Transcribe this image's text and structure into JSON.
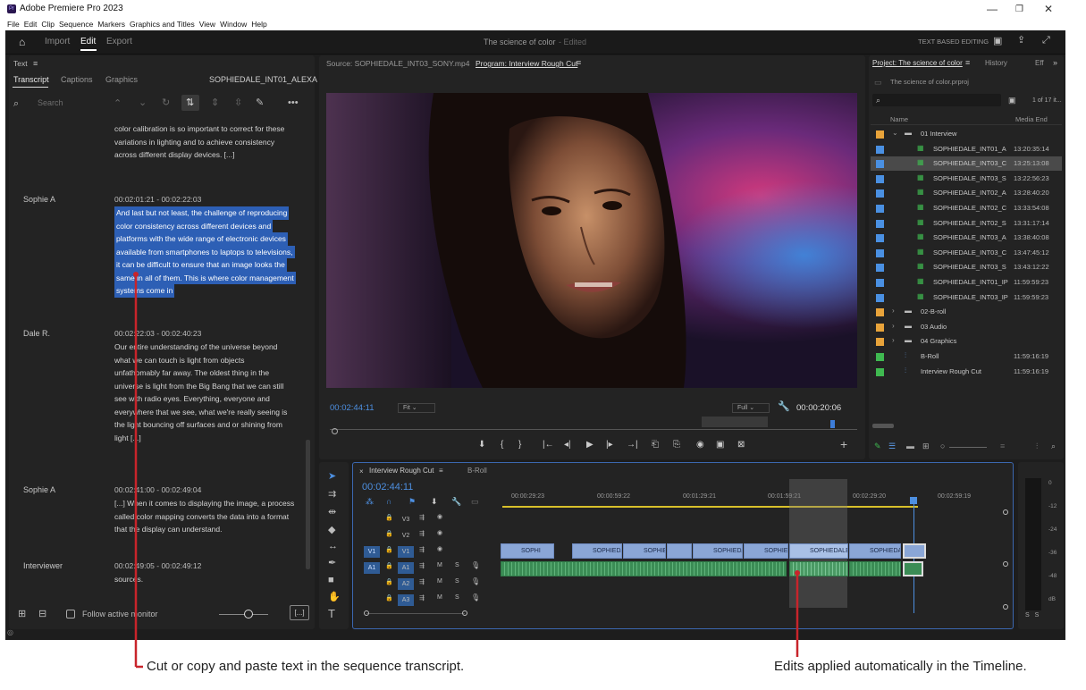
{
  "app": {
    "title": "Adobe Premiere Pro 2023",
    "logo_text": "Pr",
    "menus": [
      "File",
      "Edit",
      "Clip",
      "Sequence",
      "Markers",
      "Graphics and Titles",
      "View",
      "Window",
      "Help"
    ],
    "modes": [
      "Import",
      "Edit",
      "Export"
    ],
    "active_mode": "Edit",
    "project_name": "The science of color",
    "edited": "- Edited",
    "text_based_editing": "TEXT BASED EDITING"
  },
  "text_panel": {
    "title": "Text",
    "tabs": [
      "Transcript",
      "Captions",
      "Graphics"
    ],
    "active_tab": "Transcript",
    "clip_name": "SOPHIEDALE_INT01_ALEXA",
    "search_placeholder": "Search",
    "follow_label": "Follow active monitor",
    "ellipsis_btn": "[...]",
    "blocks": [
      {
        "speaker": "",
        "time": "",
        "lines": [
          "color calibration is so important to correct for these",
          "variations in lighting and to achieve consistency",
          "across different display devices. [...]"
        ],
        "highlight": false
      },
      {
        "speaker": "Sophie A",
        "time": "00:02:01:21 - 00:02:22:03",
        "lines": [
          "And last but not least, the challenge of reproducing",
          "color consistency across different devices and",
          "platforms with the wide range of electronic devices",
          "available from smartphones to laptops to televisions,",
          "it can be difficult to ensure that an image looks the",
          "same in all of them. This is where color management",
          "systems come in"
        ],
        "highlight": true
      },
      {
        "speaker": "Dale R.",
        "time": "00:02:22:03 - 00:02:40:23",
        "lines": [
          "Our entire understanding of the universe beyond",
          "what we can touch is light from objects",
          "unfathomably far away. The oldest thing in the",
          "universe is light from the Big Bang that we can still",
          "see with radio eyes. Everything, everyone and",
          "everywhere that we see, what we're really seeing is",
          "the light bouncing off surfaces and or shining from",
          "light [...]"
        ],
        "highlight": false
      },
      {
        "speaker": "Sophie A",
        "time": "00:02:41:00 - 00:02:49:04",
        "lines": [
          "[...] When it comes to displaying the image, a process",
          "called color mapping converts the data into a format",
          "that the display can understand."
        ],
        "highlight": false
      },
      {
        "speaker": "Interviewer",
        "time": "00:02:49:05 - 00:02:49:12",
        "lines": [
          "sources."
        ],
        "highlight": false
      }
    ]
  },
  "monitor": {
    "source_tab": "Source: SOPHIEDALE_INT03_SONY.mp4",
    "program_tab": "Program: Interview Rough Cut",
    "timecode": "00:02:44:11",
    "fit": "Fit",
    "full": "Full",
    "duration": "00:00:20:06"
  },
  "project": {
    "tabs": [
      "Project: The science of color",
      "History",
      "Eff"
    ],
    "file": "The science of color.prproj",
    "count": "1 of 17 it...",
    "col_name": "Name",
    "col_end": "Media End",
    "items": [
      {
        "name": "01 Interview",
        "end": "",
        "type": "bin",
        "color": "#e8a33a",
        "open": true,
        "indent": 0
      },
      {
        "name": "SOPHIEDALE_INT01_A",
        "end": "13:20:35:14",
        "type": "clip",
        "color": "#4a90e2",
        "indent": 1
      },
      {
        "name": "SOPHIEDALE_INT03_C",
        "end": "13:25:13:08",
        "type": "clip",
        "color": "#4a90e2",
        "indent": 1,
        "selected": true
      },
      {
        "name": "SOPHIEDALE_INT03_S",
        "end": "13:22:56:23",
        "type": "clip",
        "color": "#4a90e2",
        "indent": 1
      },
      {
        "name": "SOPHIEDALE_INT02_A",
        "end": "13:28:40:20",
        "type": "clip",
        "color": "#4a90e2",
        "indent": 1
      },
      {
        "name": "SOPHIEDALE_INT02_C",
        "end": "13:33:54:08",
        "type": "clip",
        "color": "#4a90e2",
        "indent": 1
      },
      {
        "name": "SOPHIEDALE_INT02_S",
        "end": "13:31:17:14",
        "type": "clip",
        "color": "#4a90e2",
        "indent": 1
      },
      {
        "name": "SOPHIEDALE_INT03_A",
        "end": "13:38:40:08",
        "type": "clip",
        "color": "#4a90e2",
        "indent": 1
      },
      {
        "name": "SOPHIEDALE_INT03_C",
        "end": "13:47:45:12",
        "type": "clip",
        "color": "#4a90e2",
        "indent": 1
      },
      {
        "name": "SOPHIEDALE_INT03_S",
        "end": "13:43:12:22",
        "type": "clip",
        "color": "#4a90e2",
        "indent": 1
      },
      {
        "name": "SOPHIEDALE_INT01_IP",
        "end": "11:59:59:23",
        "type": "clip",
        "color": "#4a90e2",
        "indent": 1
      },
      {
        "name": "SOPHIEDALE_INT03_IP",
        "end": "11:59:59:23",
        "type": "clip",
        "color": "#4a90e2",
        "indent": 1
      },
      {
        "name": "02-B-roll",
        "end": "",
        "type": "bin",
        "color": "#e8a33a",
        "indent": 0
      },
      {
        "name": "03 Audio",
        "end": "",
        "type": "bin",
        "color": "#e8a33a",
        "indent": 0
      },
      {
        "name": "04 Graphics",
        "end": "",
        "type": "bin",
        "color": "#e8a33a",
        "indent": 0
      },
      {
        "name": "B-Roll",
        "end": "11:59:16:19",
        "type": "seq",
        "color": "#3fb950",
        "indent": 0
      },
      {
        "name": "Interview Rough Cut",
        "end": "11:59:16:19",
        "type": "seq",
        "color": "#3fb950",
        "indent": 0
      }
    ]
  },
  "timeline": {
    "tabs": [
      "Interview Rough Cut",
      "B-Roll"
    ],
    "timecode": "00:02:44:11",
    "ruler": [
      "00:00:29:23",
      "00:00:59:22",
      "00:01:29:21",
      "00:01:59:21",
      "00:02:29:20",
      "00:02:59:19"
    ],
    "video_tracks": [
      "V3",
      "V2",
      "V1"
    ],
    "audio_tracks": [
      "A1",
      "A2",
      "A3"
    ],
    "clips": [
      "SOPHI",
      "SOPHIEDA",
      "SOPHIE",
      "",
      "SOPHIEDAL",
      "SOPHIEDA",
      "SOPHIEDALE_",
      "SOPHIEDAL"
    ],
    "meter_ticks": [
      "0",
      "-12",
      "-24",
      "-36",
      "-48",
      "dB"
    ],
    "meter_solo": [
      "S",
      "S"
    ]
  },
  "captions": {
    "left": "Cut or copy and paste text in the sequence transcript.",
    "right": "Edits applied automatically in the Timeline."
  }
}
